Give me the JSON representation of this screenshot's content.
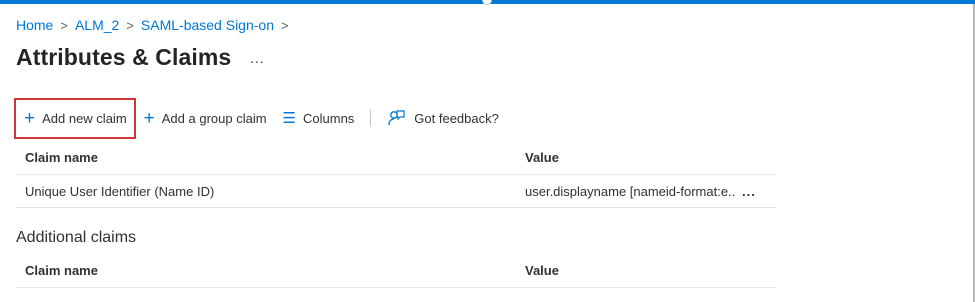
{
  "breadcrumb": {
    "items": [
      "Home",
      "ALM_2",
      "SAML-based Sign-on"
    ],
    "separator": ">"
  },
  "page": {
    "title": "Attributes & Claims",
    "more": "..."
  },
  "toolbar": {
    "add_claim": "Add new claim",
    "add_group_claim": "Add a group claim",
    "columns": "Columns",
    "feedback": "Got feedback?"
  },
  "required_claims": {
    "columns": [
      "Claim name",
      "Value"
    ],
    "rows": [
      {
        "name": "Unique User Identifier (Name ID)",
        "value": "user.displayname [nameid-format:e...",
        "more": "..."
      }
    ]
  },
  "additional_claims": {
    "title": "Additional claims",
    "columns": [
      "Claim name",
      "Value"
    ]
  },
  "colors": {
    "accent": "#0078d4",
    "highlight": "#d13438"
  }
}
